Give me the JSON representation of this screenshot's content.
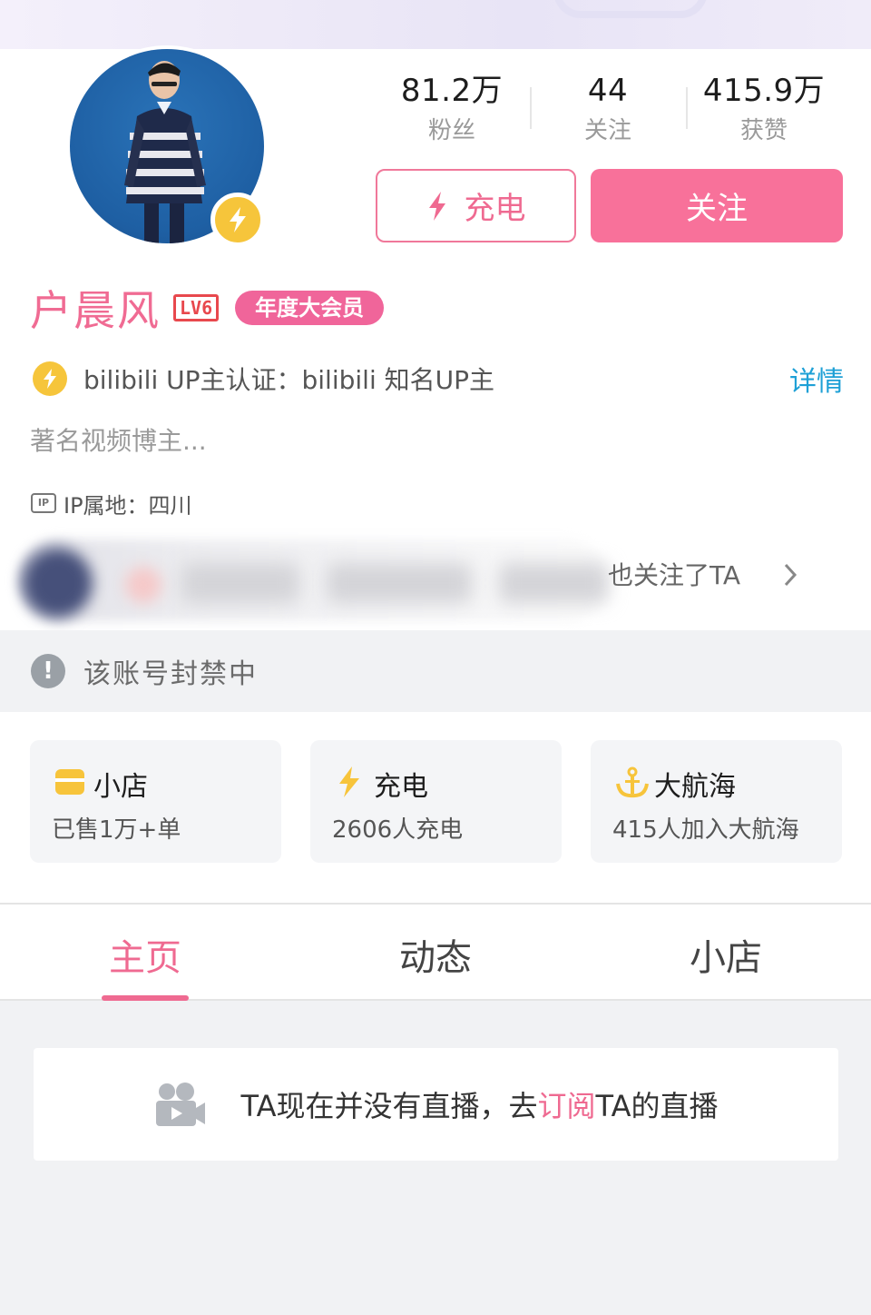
{
  "profile": {
    "name": "户晨风",
    "level": "LV6",
    "vip_label": "年度大会员",
    "stats": [
      {
        "value": "81.2万",
        "label": "粉丝"
      },
      {
        "value": "44",
        "label": "关注"
      },
      {
        "value": "415.9万",
        "label": "获赞"
      }
    ],
    "charge_button": "充电",
    "follow_button": "关注",
    "certification": "bilibili UP主认证：bilibili 知名UP主",
    "certification_detail": "详情",
    "bio": "著名视频博主...",
    "ip_icon": "IP",
    "ip_location": "IP属地：四川",
    "mutual_follow_text": "也关注了TA"
  },
  "banned_notice": "该账号封禁中",
  "cards": [
    {
      "icon": "shop-icon",
      "title": "小店",
      "subtitle": "已售1万+单"
    },
    {
      "icon": "lightning-icon",
      "title": "充电",
      "subtitle": "2606人充电"
    },
    {
      "icon": "anchor-icon",
      "title": "大航海",
      "subtitle": "415人加入大航海"
    }
  ],
  "tabs": [
    {
      "label": "主页",
      "active": true
    },
    {
      "label": "动态",
      "active": false
    },
    {
      "label": "小店",
      "active": false
    }
  ],
  "live": {
    "text_before": "TA现在并没有直播，去",
    "link": "订阅",
    "text_after": "TA的直播"
  },
  "colors": {
    "accent_pink": "#f8719a",
    "name_pink": "#f06b93",
    "link_blue": "#1ea0d6",
    "badge_yellow": "#f6c53b"
  }
}
